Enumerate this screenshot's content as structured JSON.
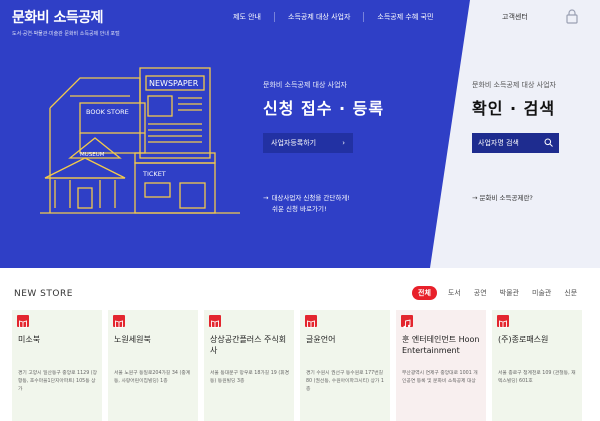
{
  "header": {
    "logo_title": "문화비 소득공제",
    "logo_sub": "도서·공연·박물관·미술관 문화비 소득공제 안내 포털",
    "nav": [
      "제도 안내",
      "소득공제 대상 사업자",
      "소득공제 수혜 국민"
    ],
    "customer_center": "고객센터"
  },
  "hero": {
    "left": {
      "subtitle": "문화비 소득공제 대상 사업자",
      "title": "신청 접수 · 등록",
      "button": "사업자등록하기",
      "link_line1": "대상사업자 신청을 간단하게!",
      "link_line2": "쉬운 신청 바로가기!"
    },
    "right": {
      "subtitle": "문화비 소득공제 대상 사업자",
      "title": "확인 · 검색",
      "search_placeholder": "사업자명 검색",
      "link": "문화비 소득공제란?"
    },
    "illustration_signs": [
      "NEWSPAPER",
      "BOOK STORE",
      "MUSEUM",
      "TICKET"
    ]
  },
  "new_store": {
    "title": "NEW STORE",
    "filters": [
      "전체",
      "도서",
      "공연",
      "박물관",
      "미술관",
      "신문"
    ],
    "active_filter": "전체",
    "cards": [
      {
        "name": "미소북",
        "address": "경기 고양시 일산동구 중앙로 1129 (장항동, 호수마을1단지아파트) 105동 상가",
        "icon": "book-icon"
      },
      {
        "name": "노원세원북",
        "address": "서울 노원구 동일로204가길 34 (중계동, 사랑어린이집빌딩) 1층",
        "icon": "book-icon"
      },
      {
        "name": "상상공간플러스 주식회사",
        "address": "서울 동대문구 망우로 18가길 19 (휘경동) 동원빌딩 3층",
        "icon": "book-icon"
      },
      {
        "name": "글윤언어",
        "address": "경기 수원시 권선구 동수원로 177번길 80 (권선동, 수원아이파크시티) 상가 1층",
        "icon": "book-icon"
      },
      {
        "name": "훈 엔터테인먼트 Hoon Entertainment",
        "address": "부산광역시 연제구 중앙대로 1001 개인공연 등록 및 문화비 소득공제 대상",
        "icon": "music-icon"
      },
      {
        "name": "(주)종로패스원",
        "address": "서울 종로구 청계천로 109 (관철동, 재텍스빌딩) 601호",
        "icon": "book-icon"
      }
    ]
  }
}
